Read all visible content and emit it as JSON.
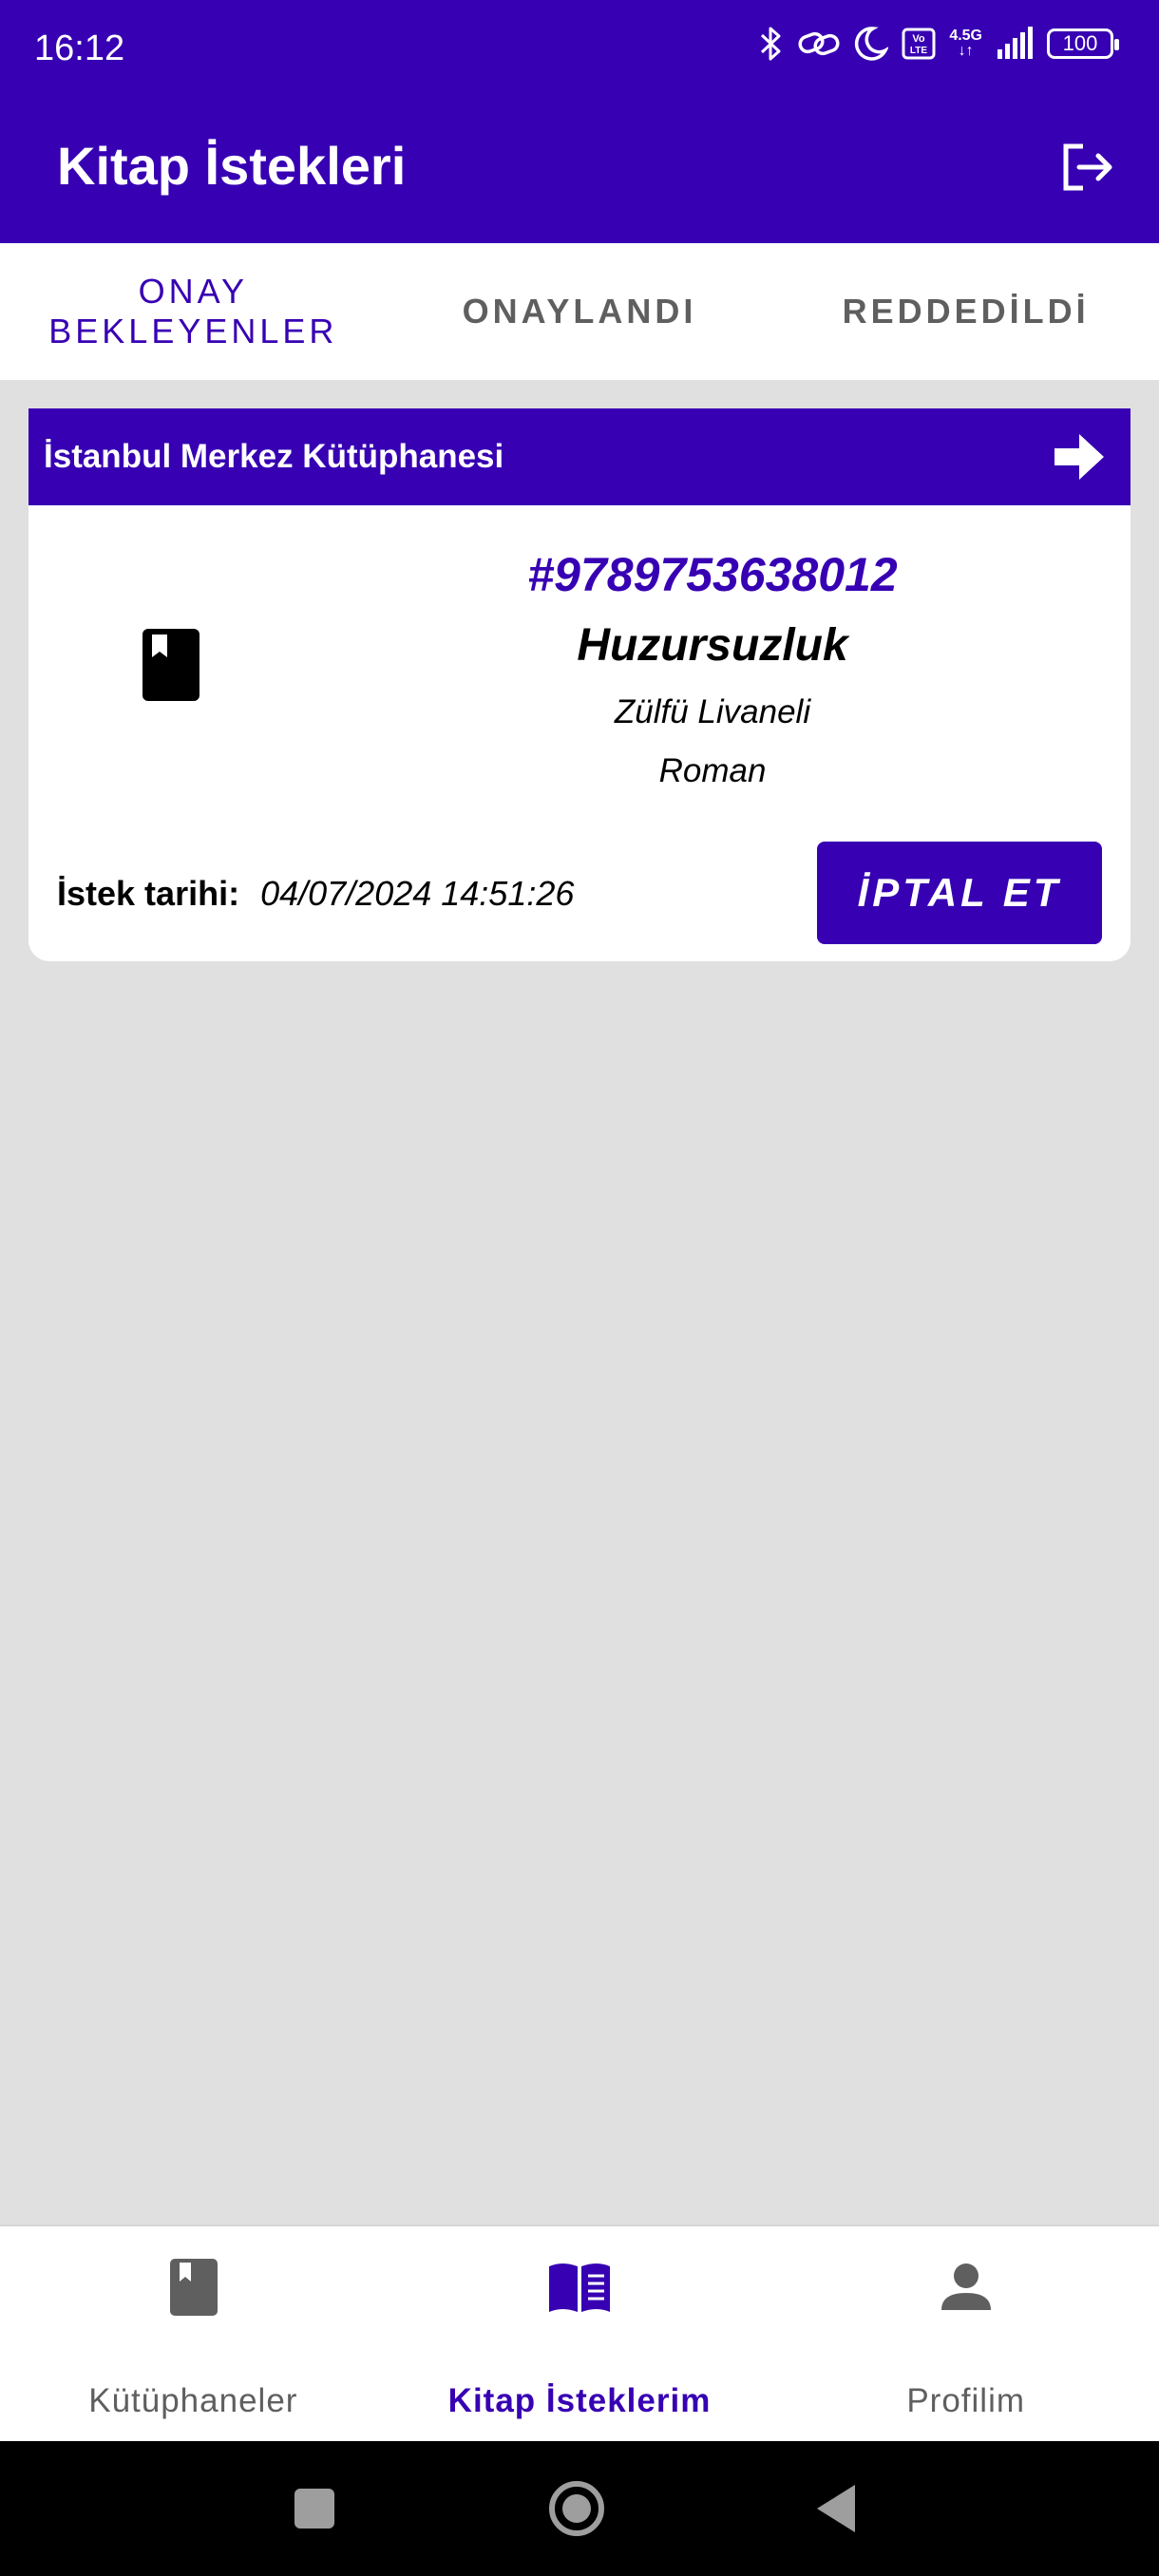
{
  "status_bar": {
    "time": "16:12",
    "network_top": "4.5G",
    "network_bottom": "↓↑",
    "volte": "Vo LTE",
    "battery": "100"
  },
  "app_bar": {
    "title": "Kitap İstekleri"
  },
  "tabs": [
    {
      "label": "ONAY BEKLEYENLER",
      "active": true
    },
    {
      "label": "ONAYLANDI",
      "active": false
    },
    {
      "label": "REDDEDİLDİ",
      "active": false
    }
  ],
  "request_card": {
    "library_name": "İstanbul Merkez Kütüphanesi",
    "isbn": "#9789753638012",
    "book_title": "Huzursuzluk",
    "author": "Zülfü Livaneli",
    "genre": "Roman",
    "date_label": "İstek tarihi:",
    "date_value": "04/07/2024 14:51:26",
    "cancel_label": "İPTAL ET"
  },
  "bottom_nav": [
    {
      "label": "Kütüphaneler",
      "icon": "book-icon",
      "active": false
    },
    {
      "label": "Kitap İsteklerim",
      "icon": "open-book-icon",
      "active": true
    },
    {
      "label": "Profilim",
      "icon": "person-icon",
      "active": false
    }
  ],
  "colors": {
    "primary": "#3700b3",
    "background": "#e0e0e0",
    "inactive": "#5f5f5f"
  }
}
